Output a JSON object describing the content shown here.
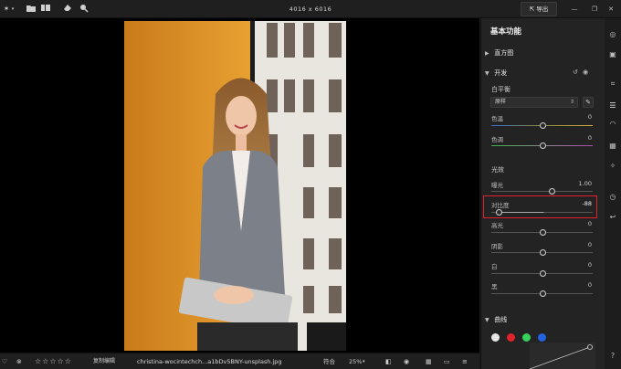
{
  "toolbar": {
    "dimensions": "4016 x 6016",
    "export_label": "导出",
    "export_icon": "export-icon",
    "app_icon": "sparkle-icon",
    "dropdown_icon": "caret-down-icon",
    "folder_icon": "folder-icon",
    "library_icon": "library-icon",
    "eraser_icon": "eraser-icon",
    "search_icon": "search-icon",
    "window_restore_icon": "restore-icon",
    "window_close_icon": "close-icon"
  },
  "panel": {
    "title": "基本功能",
    "histogram": {
      "label": "直方图"
    },
    "develop": {
      "label": "开发",
      "white_balance": {
        "label": "白平衡",
        "select_value": "原样",
        "temperature": {
          "label": "色温",
          "value": "0",
          "level": 0
        },
        "tint": {
          "label": "色调",
          "value": "0",
          "level": 0
        }
      },
      "light": {
        "label": "光效",
        "exposure": {
          "label": "曝光",
          "value": "1.00",
          "level": 0.2
        },
        "contrast": {
          "label": "对比度",
          "value": "-88",
          "level": -0.88
        },
        "highlights": {
          "label": "高光",
          "value": "0",
          "level": 0
        },
        "shadows": {
          "label": "阴影",
          "value": "0",
          "level": 0
        },
        "whites": {
          "label": "白",
          "value": "0",
          "level": 0
        },
        "blacks": {
          "label": "黑",
          "value": "0",
          "level": 0
        }
      }
    },
    "curve": {
      "label": "曲线"
    },
    "colors": {
      "white": "#e6e6e6",
      "red": "#e0232a",
      "green": "#37d05a",
      "blue": "#2462e0"
    }
  },
  "bottom": {
    "copy_edit": "复制编辑",
    "filename": "christina-wocintechch...a1bDv5BNY-unsplash.jpg",
    "fit": "符合",
    "zoom": "25%",
    "rating_stars": 5
  },
  "rail_icons": [
    "edit-icon",
    "layers-icon",
    "crop-icon",
    "sliders-icon",
    "mask-icon",
    "grid-icon",
    "magic-icon",
    "history-icon",
    "undo-icon",
    "help-icon"
  ]
}
